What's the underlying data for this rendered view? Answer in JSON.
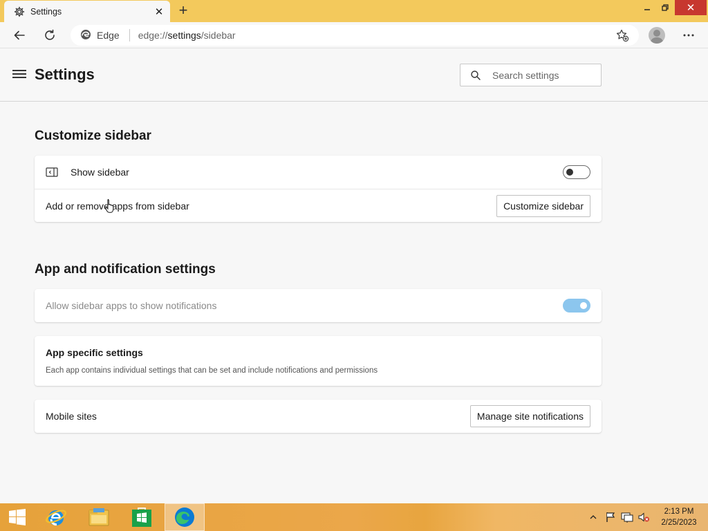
{
  "browser": {
    "tab": {
      "title": "Settings",
      "icon": "gear-icon"
    },
    "window_controls": {
      "minimize": "minimize-icon",
      "restore": "restore-icon",
      "close": "close-icon"
    },
    "address_bar": {
      "site_chip": "Edge",
      "url_scheme": "edge://",
      "url_host": "settings",
      "url_path": "/sidebar"
    }
  },
  "settings": {
    "title": "Settings",
    "search": {
      "placeholder": "Search settings"
    }
  },
  "customize_sidebar": {
    "heading": "Customize sidebar",
    "show_sidebar": {
      "label": "Show sidebar",
      "enabled": false
    },
    "add_remove": {
      "label": "Add or remove apps from sidebar",
      "button": "Customize sidebar"
    }
  },
  "app_notification": {
    "heading": "App and notification settings",
    "allow_notifications": {
      "label": "Allow sidebar apps to show notifications",
      "enabled": true,
      "disabled": true
    },
    "app_specific": {
      "title": "App specific settings",
      "description": "Each app contains individual settings that can be set and include notifications and permissions"
    },
    "mobile_sites": {
      "label": "Mobile sites",
      "button": "Manage site notifications"
    }
  },
  "taskbar": {
    "apps": [
      "start-icon",
      "internet-explorer-icon",
      "file-explorer-icon",
      "store-icon",
      "edge-icon"
    ],
    "active_app": "edge-icon",
    "clock": {
      "time": "2:13 PM",
      "date": "2/25/2023"
    }
  },
  "colors": {
    "title_bar": "#f3c95c",
    "toggle_on": "#8cc6ee",
    "close_button": "#c7372f"
  }
}
